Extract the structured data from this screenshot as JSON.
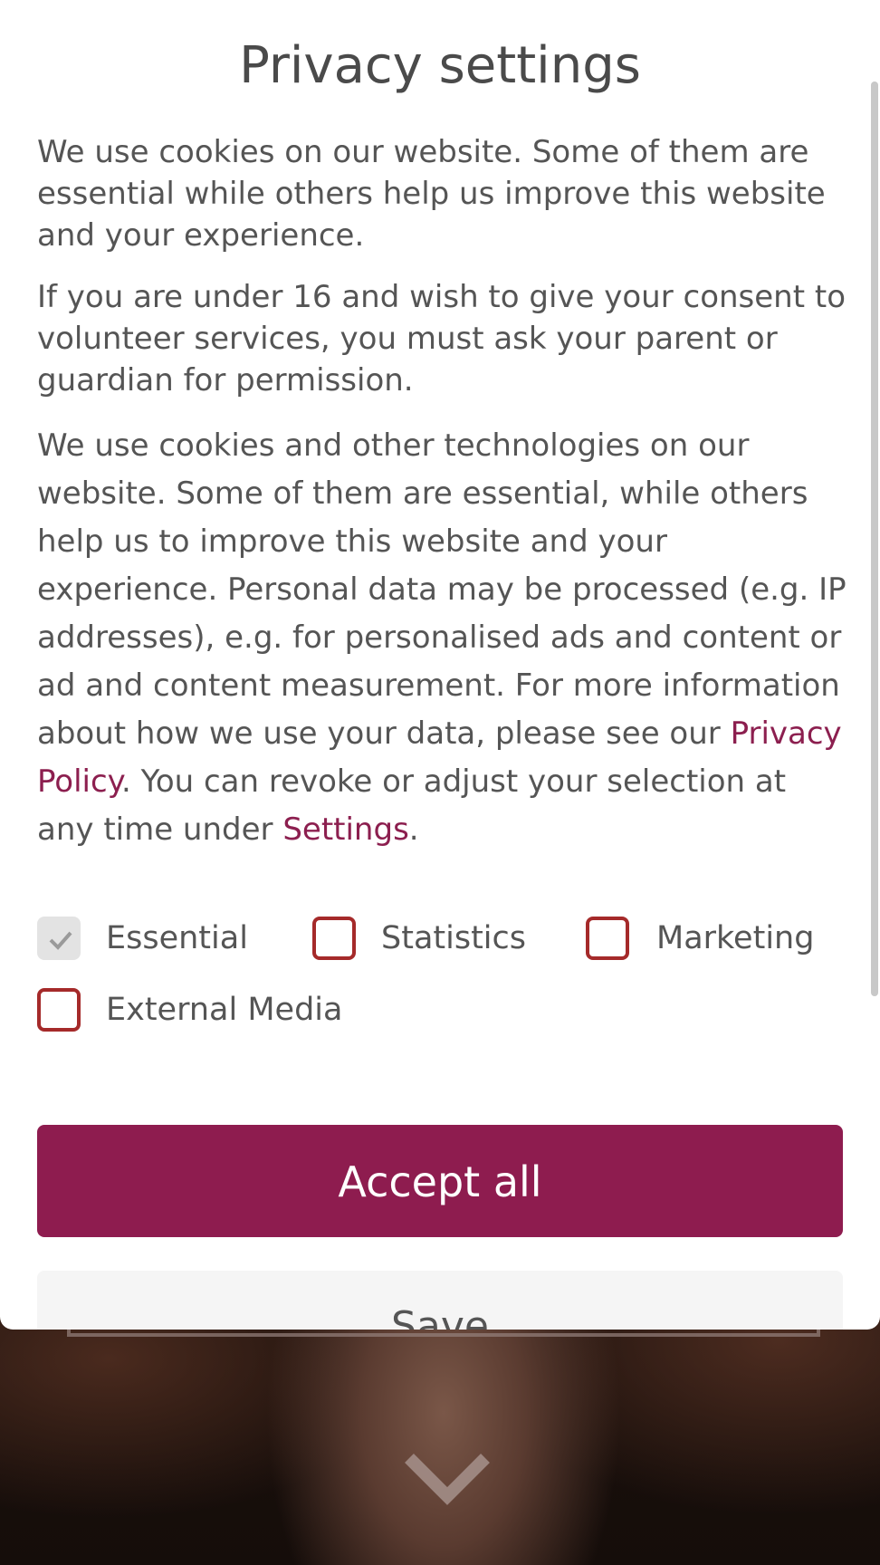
{
  "dialog": {
    "title": "Privacy settings",
    "paragraph1": "We use cookies on our website. Some of them are essential while others help us improve this website and your experience.",
    "paragraph2": "If you are under 16 and wish to give your consent to volunteer services, you must ask your parent or guardian for permission.",
    "paragraph3_part1": "We use cookies and other technologies on our website. Some of them are essential, while others help us to improve this website and your experience. Personal data may be processed (e.g. IP addresses), e.g. for personalised ads and content or ad and content measurement. For more information about how we use your data, please see our ",
    "privacy_policy_link": "Privacy Policy",
    "paragraph3_part2": ". You can revoke or adjust your selection at any time under ",
    "settings_link": "Settings",
    "paragraph3_part3": ".",
    "checkboxes": [
      {
        "label": "Essential",
        "checked": true,
        "disabled": true
      },
      {
        "label": "Statistics",
        "checked": false
      },
      {
        "label": "Marketing",
        "checked": false
      },
      {
        "label": "External Media",
        "checked": false
      }
    ],
    "accept_all_label": "Accept all",
    "save_label": "Save"
  },
  "colors": {
    "accent": "#8e1c4f",
    "link": "#8c1f4f",
    "checkbox_border": "#a52a2a",
    "text": "#555555"
  },
  "icons": {
    "scroll": "chevron-down-icon",
    "check": "checkmark-icon"
  }
}
